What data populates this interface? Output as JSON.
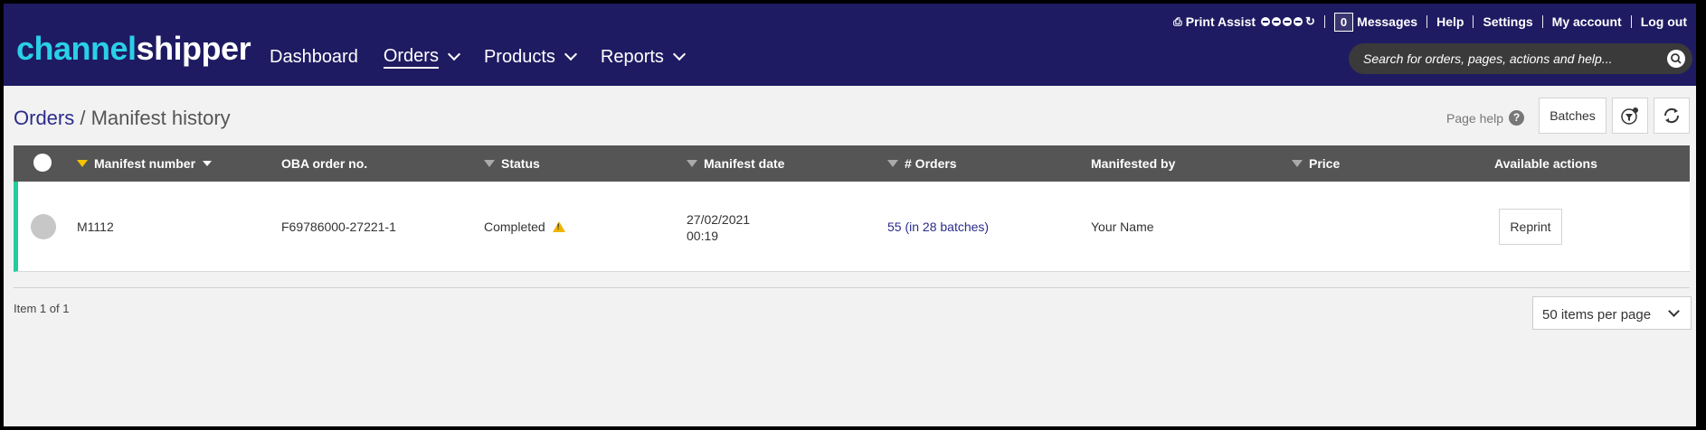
{
  "header": {
    "logo_part1": "channel",
    "logo_part2": "shipper",
    "nav": [
      {
        "label": "Dashboard"
      },
      {
        "label": "Orders"
      },
      {
        "label": "Products"
      },
      {
        "label": "Reports"
      }
    ],
    "util": {
      "print_assist": "Print Assist",
      "messages_count": "0",
      "messages": "Messages",
      "help": "Help",
      "settings": "Settings",
      "my_account": "My account",
      "log_out": "Log out"
    },
    "search_placeholder": "Search for orders, pages, actions and help..."
  },
  "breadcrumb": {
    "root": "Orders",
    "separator": " / ",
    "current": "Manifest history"
  },
  "toolbar": {
    "page_help": "Page help",
    "batches": "Batches"
  },
  "table": {
    "columns": [
      "Manifest number",
      "OBA order no.",
      "Status",
      "Manifest date",
      "# Orders",
      "Manifested by",
      "Price",
      "Available actions"
    ],
    "rows": [
      {
        "manifest_number": "M1112",
        "oba_order_no": "F69786000-27221-1",
        "status": "Completed",
        "manifest_date": "27/02/2021",
        "manifest_time": "00:19",
        "orders_count": "55 (in ",
        "orders_batches": "28 batches",
        "orders_close": ")",
        "manifested_by": "Your Name",
        "price": "",
        "action": "Reprint"
      }
    ]
  },
  "pager": {
    "summary": "Item 1 of 1",
    "per_page": "50 items per page"
  },
  "colors": {
    "header_bg": "#1f1b62",
    "logo_accent": "#2ad0e8",
    "table_header_bg": "#555555",
    "row_accent": "#1fcf9b",
    "link": "#2c2c8c",
    "warning": "#f0b400",
    "filter_active": "#f5c400"
  }
}
